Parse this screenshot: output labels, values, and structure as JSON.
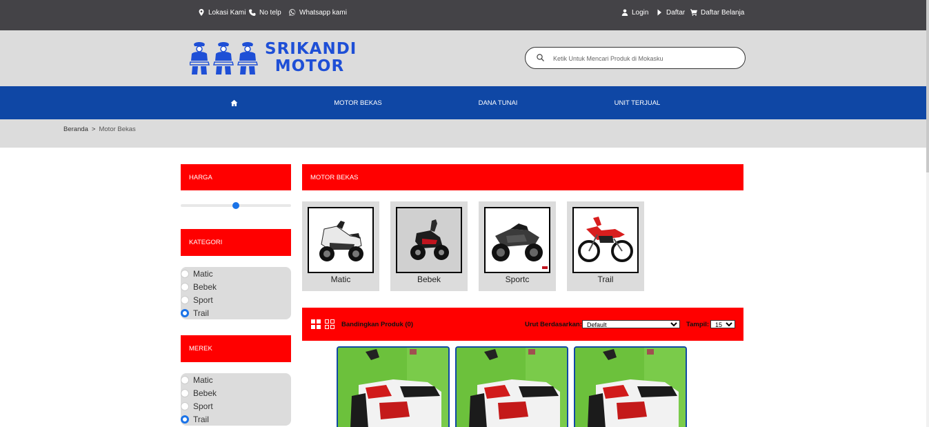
{
  "topbar": {
    "location": "Lokasi Kami",
    "phone": "No telp",
    "whatsapp": "Whatsapp kami",
    "login": "Login",
    "register": "Daftar",
    "cart": "Daftar Belanja"
  },
  "brand": {
    "line1": "SRIKANDI",
    "line2": "MOTOR",
    "color": "#1e4fd6"
  },
  "search": {
    "placeholder": "Ketik Untuk Mencari Produk di Mokasku"
  },
  "nav": {
    "home_icon": "home-icon",
    "items": [
      "MOTOR BEKAS",
      "DANA TUNAI",
      "UNIT TERJUAL"
    ]
  },
  "breadcrumb": {
    "home": "Beranda",
    "separator": ">",
    "current": "Motor Bekas"
  },
  "sidebar": {
    "price_title": "HARGA",
    "price_slider_fraction": 0.5,
    "category_title": "KATEGORI",
    "category_options": [
      "Matic",
      "Bebek",
      "Sport",
      "Trail"
    ],
    "category_selected": "Trail",
    "brand_title": "MEREK",
    "brand_options": [
      "Matic",
      "Bebek",
      "Sport",
      "Trail"
    ],
    "brand_selected": "Trail"
  },
  "main": {
    "section_title": "MOTOR BEKAS",
    "categories": [
      "Matic",
      "Bebek",
      "Sportc",
      "Trail"
    ],
    "toolbar": {
      "compare": "Bandingkan Produk (0)",
      "sort_label": "Urut Berdasarkan:",
      "sort_value": "Default",
      "show_label": "Tampil:",
      "show_value": "15"
    }
  },
  "colors": {
    "topbar": "#444347",
    "nav": "#0f47a5",
    "accent_red": "#ff0000",
    "header_gray": "#dcdcdc"
  }
}
